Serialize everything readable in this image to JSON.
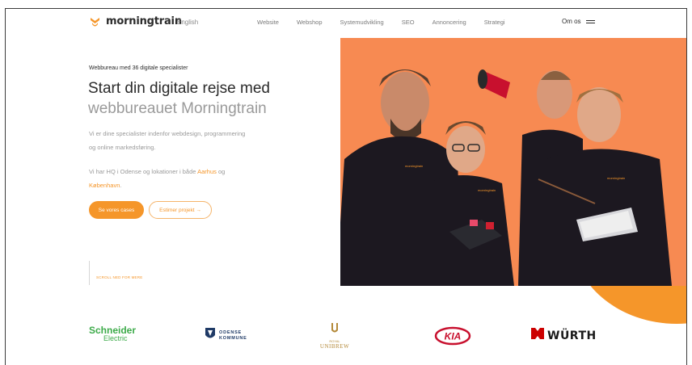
{
  "header": {
    "logo_text": "morningtrain",
    "language": "English",
    "nav": [
      "Website",
      "Webshop",
      "Systemudvikling",
      "SEO",
      "Annoncering",
      "Strategi"
    ],
    "about": "Om os"
  },
  "hero": {
    "eyebrow": "Webbureau med 36 digitale specialister",
    "title_line1": "Start din digitale rejse med",
    "title_line2": "webbureauet Morningtrain",
    "para1": "Vi er dine specialister indenfor webdesign, programmering og online markedsføring.",
    "para2_prefix": "Vi har HQ i Odense og lokationer i både ",
    "para2_link1": "Aarhus",
    "para2_mid": " og ",
    "para2_link2": "København",
    "para2_suffix": ".",
    "btn_primary": "Se vores cases",
    "btn_outline": "Estimer projekt →",
    "scroll_hint": "SCROLL NED FOR MERE"
  },
  "logos": {
    "schneider_line1": "Schneider",
    "schneider_line2": "Electric",
    "odense_line1": "ODENSE",
    "odense_line2": "KOMMUNE",
    "unibrew_top": "ROYAL",
    "unibrew_name": "UNIBREW",
    "kia": "KIA",
    "wurth": "WÜRTH"
  },
  "colors": {
    "accent": "#f5962a",
    "hero_bg": "#f78a52",
    "schneider_green": "#3dab4a",
    "kia_red": "#c8102e",
    "wurth_red": "#cc0000"
  },
  "icons": {
    "logo_mark": "morningtrain-logo-icon",
    "menu": "hamburger-menu-icon"
  }
}
